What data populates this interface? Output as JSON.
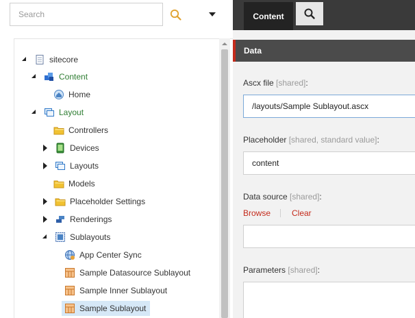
{
  "search": {
    "placeholder": "Search"
  },
  "tree": [
    {
      "label": "sitecore",
      "expander": "open",
      "icon": "page-icon",
      "color": "default"
    },
    {
      "label": "Content",
      "expander": "open",
      "icon": "content-icon",
      "color": "green"
    },
    {
      "label": "Home",
      "expander": "none",
      "icon": "home-icon",
      "color": "default"
    },
    {
      "label": "Layout",
      "expander": "open",
      "icon": "layout-icon",
      "color": "green"
    },
    {
      "label": "Controllers",
      "expander": "none",
      "icon": "folder-icon",
      "color": "default"
    },
    {
      "label": "Devices",
      "expander": "closed",
      "icon": "device-icon",
      "color": "default"
    },
    {
      "label": "Layouts",
      "expander": "closed",
      "icon": "layout-icon",
      "color": "default"
    },
    {
      "label": "Models",
      "expander": "none",
      "icon": "folder-icon",
      "color": "default"
    },
    {
      "label": "Placeholder Settings",
      "expander": "closed",
      "icon": "folder-icon",
      "color": "default"
    },
    {
      "label": "Renderings",
      "expander": "closed",
      "icon": "renderings-icon",
      "color": "default"
    },
    {
      "label": "Sublayouts",
      "expander": "open",
      "icon": "sublayouts-icon",
      "color": "default"
    },
    {
      "label": "App Center Sync",
      "expander": "none",
      "icon": "globe-icon",
      "color": "default"
    },
    {
      "label": "Sample Datasource Sublayout",
      "expander": "none",
      "icon": "sublayout-icon",
      "color": "default"
    },
    {
      "label": "Sample Inner Sublayout",
      "expander": "none",
      "icon": "sublayout-icon",
      "color": "default"
    },
    {
      "label": "Sample Sublayout",
      "expander": "none",
      "icon": "sublayout-icon",
      "color": "default",
      "selected": true
    }
  ],
  "tabs": {
    "content": "Content"
  },
  "section": {
    "title": "Data"
  },
  "fields": {
    "ascx": {
      "label": "Ascx file",
      "meta": "[shared]",
      "colon": ":",
      "value": "/layouts/Sample Sublayout.ascx"
    },
    "placeholder": {
      "label": "Placeholder",
      "meta": "[shared, standard value]",
      "colon": ":",
      "value": "content"
    },
    "datasource": {
      "label": "Data source",
      "meta": "[shared]",
      "colon": ":",
      "value": "",
      "browse": "Browse",
      "clear": "Clear"
    },
    "parameters": {
      "label": "Parameters",
      "meta": "[shared]",
      "colon": ":"
    }
  },
  "colors": {
    "accent": "#c42b1c",
    "tab_active": "#232323",
    "topbar": "#3a3a3a",
    "section": "#4b4b4b",
    "green_label": "#2e7d32"
  }
}
